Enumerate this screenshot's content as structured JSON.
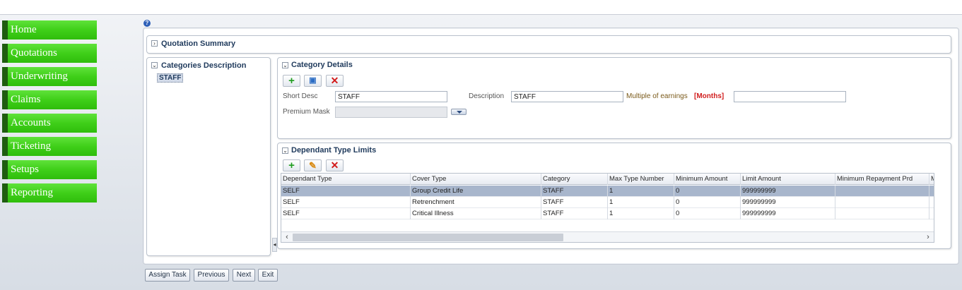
{
  "nav": {
    "items": [
      "Home",
      "Quotations",
      "Underwriting",
      "Claims",
      "Accounts",
      "Ticketing",
      "Setups",
      "Reporting"
    ]
  },
  "help_icon": "?",
  "quotation_summary": {
    "title": "Quotation Summary",
    "icon": "chevron-right-icon"
  },
  "categories": {
    "title": "Categories Description",
    "selected_node": "STAFF"
  },
  "category_details": {
    "title": "Category Details",
    "toolbar": [
      "add-icon",
      "save-icon",
      "delete-icon"
    ],
    "short_desc_label": "Short Desc",
    "short_desc_value": "STAFF",
    "description_label": "Description",
    "description_value": "STAFF",
    "multiple_label": "Multiple of earnings",
    "months_label": "[Months]",
    "multiple_value": "",
    "premium_mask_label": "Premium Mask",
    "premium_mask_value": ""
  },
  "dependant_limits": {
    "title": "Dependant Type Limits",
    "toolbar": [
      "add-icon",
      "edit-icon",
      "delete-icon"
    ],
    "columns": [
      "Dependant Type",
      "Cover Type",
      "Category",
      "Max Type Number",
      "Minimum Amount",
      "Limit Amount",
      "Minimum Repayment Prd",
      "M"
    ],
    "rows": [
      [
        "SELF",
        "Group Credit Life",
        "STAFF",
        "1",
        "0",
        "999999999",
        "",
        ""
      ],
      [
        "SELF",
        "Retrenchment",
        "STAFF",
        "1",
        "0",
        "999999999",
        "",
        ""
      ],
      [
        "SELF",
        "Critical Illness",
        "STAFF",
        "1",
        "0",
        "999999999",
        "",
        ""
      ]
    ],
    "selected_row": 0
  },
  "buttons": {
    "assign": "Assign Task",
    "previous": "Previous",
    "next": "Next",
    "exit": "Exit"
  },
  "colors": {
    "nav_green": "#3fcf19",
    "nav_dark": "#1f5d10",
    "title_blue": "#1f3a5c",
    "selected_row": "#a8b6cc",
    "months_red": "#d11e1e"
  }
}
